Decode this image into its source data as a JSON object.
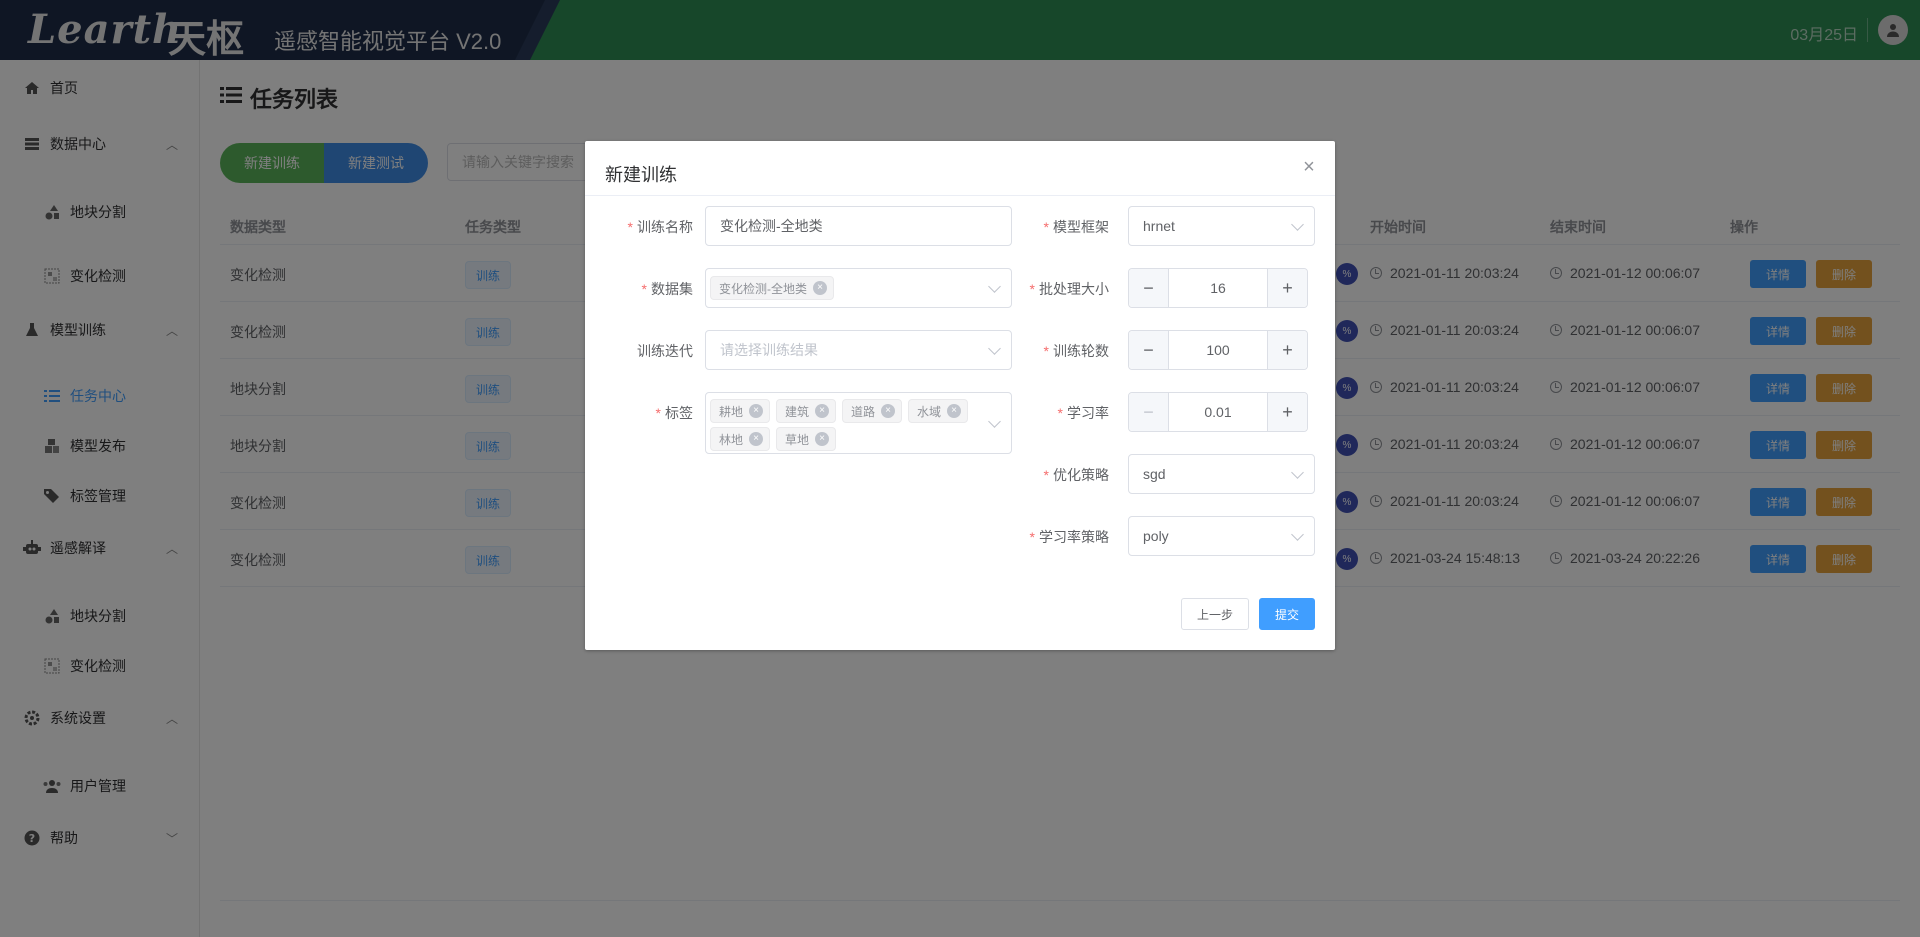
{
  "header": {
    "logo_text": "Learth",
    "logo_cn": "天枢",
    "platform_title": "遥感智能视觉平台 V2.0",
    "date": "03月25日"
  },
  "sidebar": {
    "items": [
      {
        "label": "首页",
        "icon": "home-icon"
      },
      {
        "label": "数据中心",
        "icon": "database-icon"
      },
      {
        "label": "地块分割",
        "icon": "shapes-icon"
      },
      {
        "label": "变化检测",
        "icon": "image-grid-icon"
      },
      {
        "label": "模型训练",
        "icon": "flask-icon"
      },
      {
        "label": "任务中心",
        "icon": "list-check-icon"
      },
      {
        "label": "模型发布",
        "icon": "cubes-icon"
      },
      {
        "label": "标签管理",
        "icon": "tags-icon"
      },
      {
        "label": "遥感解译",
        "icon": "robot-icon"
      },
      {
        "label": "地块分割",
        "icon": "shapes-icon"
      },
      {
        "label": "变化检测",
        "icon": "image-grid-icon"
      },
      {
        "label": "系统设置",
        "icon": "gear-icon"
      },
      {
        "label": "用户管理",
        "icon": "users-icon"
      },
      {
        "label": "帮助",
        "icon": "question-icon"
      }
    ]
  },
  "main": {
    "page_title": "任务列表",
    "new_train_label": "新建训练",
    "new_test_label": "新建测试",
    "search_placeholder": "请输入关键字搜索",
    "table": {
      "headers": {
        "data_type": "数据类型",
        "task_type": "任务类型",
        "start_time": "开始时间",
        "end_time": "结束时间",
        "actions": "操作"
      },
      "rows": [
        {
          "data_type": "变化检测",
          "task_tag": "训练",
          "pct": "%",
          "start": "2021-01-11 20:03:24",
          "end": "2021-01-12 00:06:07"
        },
        {
          "data_type": "变化检测",
          "task_tag": "训练",
          "pct": "%",
          "start": "2021-01-11 20:03:24",
          "end": "2021-01-12 00:06:07"
        },
        {
          "data_type": "地块分割",
          "task_tag": "训练",
          "pct": "%",
          "start": "2021-01-11 20:03:24",
          "end": "2021-01-12 00:06:07"
        },
        {
          "data_type": "地块分割",
          "task_tag": "训练",
          "pct": "%",
          "start": "2021-01-11 20:03:24",
          "end": "2021-01-12 00:06:07"
        },
        {
          "data_type": "变化检测",
          "task_tag": "训练",
          "pct": "%",
          "start": "2021-01-11 20:03:24",
          "end": "2021-01-12 00:06:07"
        },
        {
          "data_type": "变化检测",
          "task_tag": "训练",
          "pct": "%",
          "start": "2021-03-24 15:48:13",
          "end": "2021-03-24 20:22:26"
        }
      ],
      "detail_label": "详情",
      "delete_label": "删除"
    }
  },
  "dialog": {
    "title": "新建训练",
    "close_icon": "close-icon",
    "fields": {
      "train_name": {
        "label": "训练名称",
        "value": "变化检测-全地类"
      },
      "dataset": {
        "label": "数据集",
        "chip": "变化检测-全地类"
      },
      "train_iter": {
        "label": "训练迭代",
        "placeholder": "请选择训练结果"
      },
      "labels": {
        "label": "标签",
        "chips": [
          "耕地",
          "建筑",
          "道路",
          "水域",
          "林地",
          "草地"
        ]
      },
      "framework": {
        "label": "模型框架",
        "value": "hrnet"
      },
      "batch_size": {
        "label": "批处理大小",
        "value": "16"
      },
      "epochs": {
        "label": "训练轮数",
        "value": "100"
      },
      "learning_rate": {
        "label": "学习率",
        "value": "0.01"
      },
      "optimizer": {
        "label": "优化策略",
        "value": "sgd"
      },
      "lr_policy": {
        "label": "学习率策略",
        "value": "poly"
      }
    },
    "prev_label": "上一步",
    "submit_label": "提交"
  },
  "colors": {
    "header_green": "#2e8f55",
    "primary": "#409eff",
    "warning": "#e6a23c",
    "success": "#5bb55a"
  }
}
